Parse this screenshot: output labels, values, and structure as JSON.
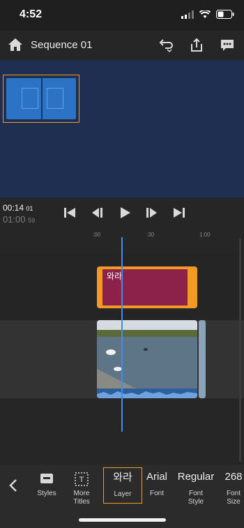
{
  "status": {
    "time": "4:52"
  },
  "header": {
    "title": "Sequence 01",
    "icons": [
      "home-icon",
      "undo-icon",
      "share-icon",
      "comment-icon"
    ]
  },
  "playback": {
    "current_time": "00:14",
    "current_frame": "01",
    "total_time": "01:00",
    "total_frame": "59"
  },
  "timeline": {
    "ruler": [
      ":00",
      ":30",
      "1:00"
    ],
    "title_clip_text": "와라",
    "playhead_color": "#3d8ef2"
  },
  "toolbar": {
    "styles_label": "Styles",
    "more_titles_label": "More\nTitles",
    "layer_value": "와라",
    "layer_label": "Layer",
    "font_value": "Arial",
    "font_label": "Font",
    "font_style_value": "Regular",
    "font_style_label": "Font\nStyle",
    "font_size_value": "268",
    "font_size_label": "Font\nSize"
  },
  "colors": {
    "accent": "#f39c26",
    "preview_bg": "#1f2f52",
    "title_clip": "#8c2149"
  }
}
